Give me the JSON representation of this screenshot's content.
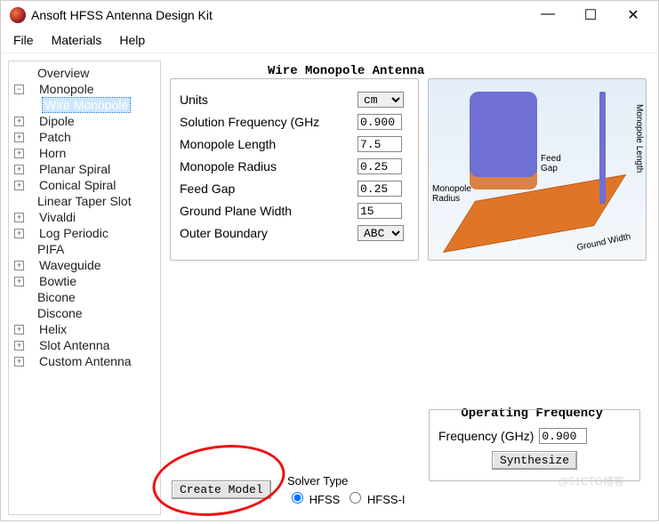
{
  "title": "Ansoft HFSS Antenna Design Kit",
  "menu": {
    "file": "File",
    "materials": "Materials",
    "help": "Help"
  },
  "tree": {
    "items": [
      {
        "label": "Overview",
        "expand": ""
      },
      {
        "label": "Monopole",
        "expand": "−"
      },
      {
        "label": "Wire Monopole",
        "expand": "",
        "child": true,
        "selected": true
      },
      {
        "label": "Dipole",
        "expand": "+"
      },
      {
        "label": "Patch",
        "expand": "+"
      },
      {
        "label": "Horn",
        "expand": "+"
      },
      {
        "label": "Planar Spiral",
        "expand": "+"
      },
      {
        "label": "Conical Spiral",
        "expand": "+"
      },
      {
        "label": "Linear Taper Slot",
        "expand": ""
      },
      {
        "label": "Vivaldi",
        "expand": "+"
      },
      {
        "label": "Log Periodic",
        "expand": "+"
      },
      {
        "label": "PIFA",
        "expand": ""
      },
      {
        "label": "Waveguide",
        "expand": "+"
      },
      {
        "label": "Bowtie",
        "expand": "+"
      },
      {
        "label": "Bicone",
        "expand": ""
      },
      {
        "label": "Discone",
        "expand": ""
      },
      {
        "label": "Helix",
        "expand": "+"
      },
      {
        "label": "Slot Antenna",
        "expand": "+"
      },
      {
        "label": "Custom Antenna",
        "expand": "+"
      }
    ]
  },
  "panel": {
    "title": "Wire Monopole Antenna",
    "units_label": "Units",
    "units_value": "cm",
    "solfreq_label": "Solution Frequency (GHz",
    "solfreq_value": "0.900",
    "monolen_label": "Monopole Length",
    "monolen_value": "7.5",
    "monorad_label": "Monopole Radius",
    "monorad_value": "0.25",
    "feedgap_label": "Feed Gap",
    "feedgap_value": "0.25",
    "gpw_label": "Ground Plane Width",
    "gpw_value": "15",
    "outer_label": "Outer Boundary",
    "outer_value": "ABC"
  },
  "diagram": {
    "feed_gap": "Feed\nGap",
    "mono_radius": "Monopole\nRadius",
    "mono_length": "Monopole Length",
    "ground_width": "Ground Width"
  },
  "opfreq": {
    "title": "Operating Frequency",
    "label": "Frequency (GHz)",
    "value": "0.900",
    "synth": "Synthesize"
  },
  "create": "Create Model",
  "solver": {
    "title": "Solver Type",
    "opt1": "HFSS",
    "opt2": "HFSS-I"
  },
  "watermark": "@51CTO博客"
}
